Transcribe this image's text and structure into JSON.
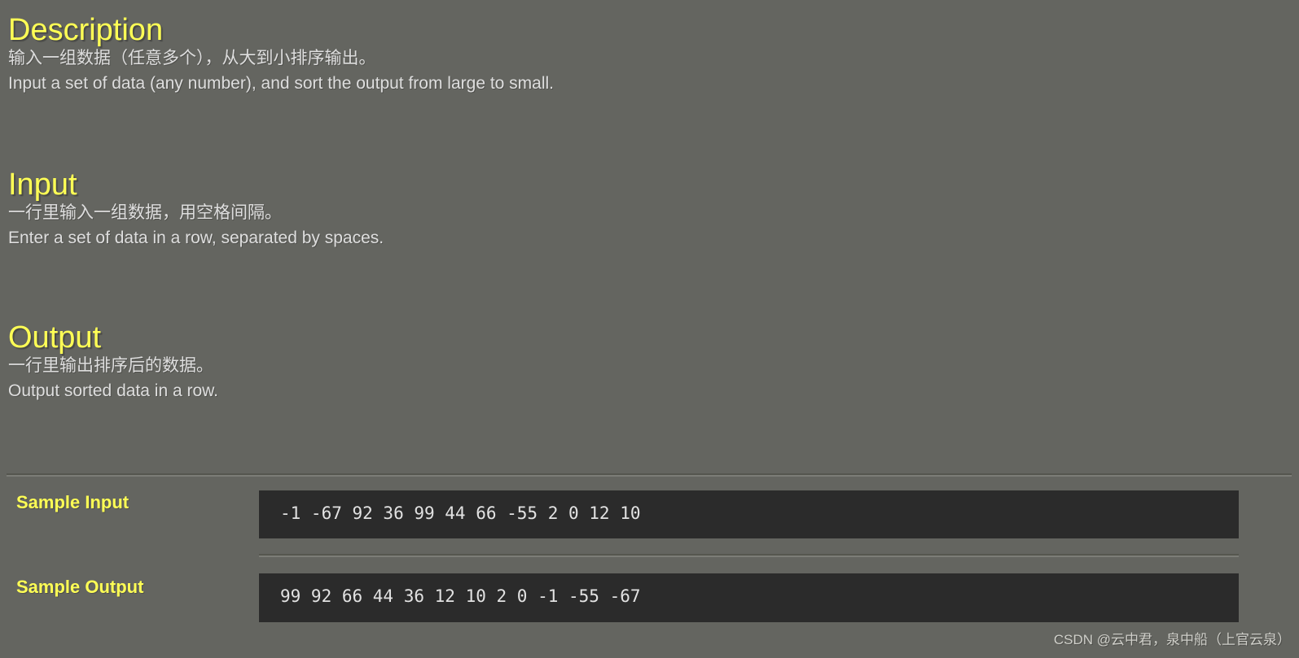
{
  "page": {
    "background_color": "#646560",
    "heading_color": "#ffff55",
    "body_text_color": "#dedede",
    "code_background_color": "#2b2b2b",
    "code_text_color": "#e2e2e2"
  },
  "sections": {
    "description": {
      "heading": "Description",
      "line_cn": "输入一组数据（任意多个），从大到小排序输出。",
      "line_en": "Input a set of data (any number), and sort the output from large to small."
    },
    "input": {
      "heading": "Input",
      "line_cn": "一行里输入一组数据，用空格间隔。",
      "line_en": "Enter a set of data in a row, separated by spaces."
    },
    "output": {
      "heading": "Output",
      "line_cn": "一行里输出排序后的数据。",
      "line_en": "Output sorted data in a row."
    }
  },
  "samples": {
    "input_label": "Sample Input",
    "input_code": "-1 -67 92 36 99 44 66 -55 2 0 12 10",
    "output_label": "Sample Output",
    "output_code": "99 92 66 44 36 12 10 2 0 -1 -55 -67"
  },
  "watermark": {
    "text": "CSDN @云中君，泉中船（上官云泉）"
  }
}
